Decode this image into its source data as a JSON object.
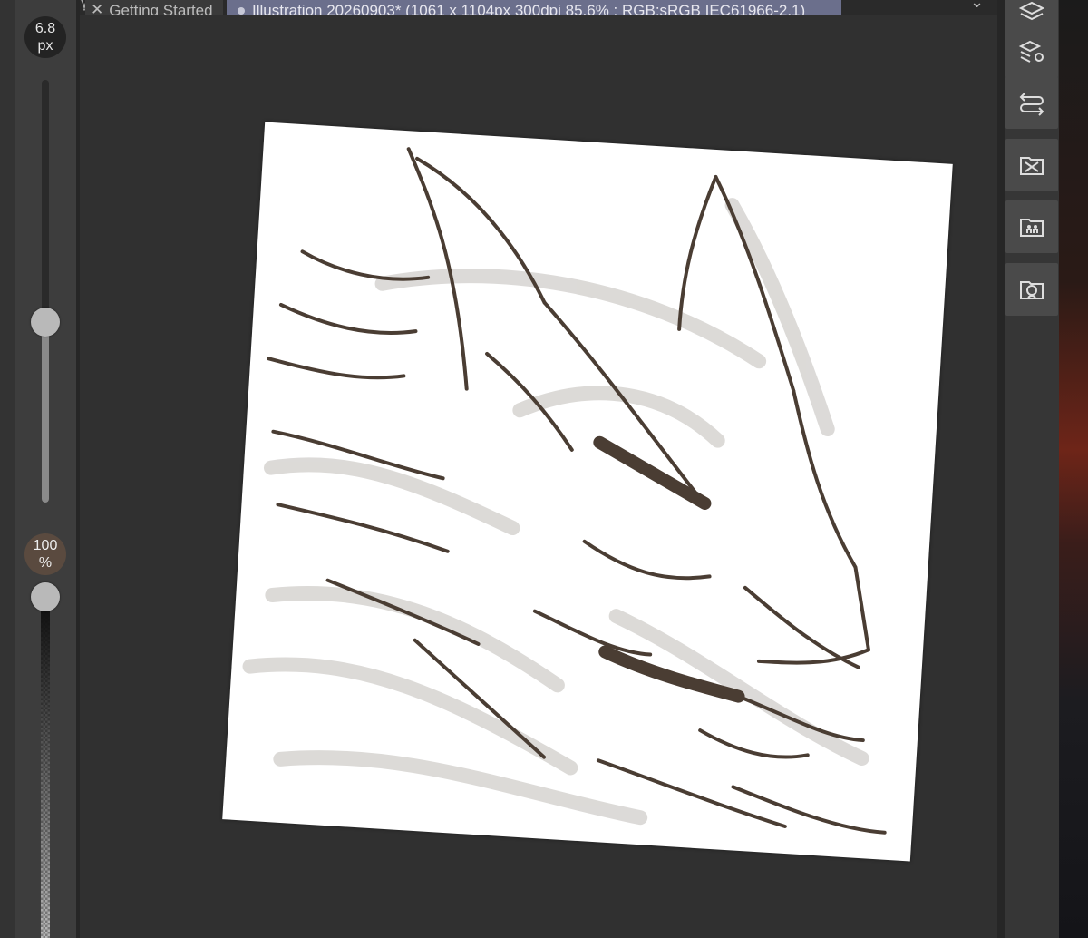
{
  "brush": {
    "size_value": "6.8",
    "size_unit": "px",
    "opacity_value": "100",
    "opacity_unit": "%"
  },
  "tabs": [
    {
      "label": "Getting Started",
      "active": false
    },
    {
      "label": "Illustration 20260903* (1061 x 1104px 300dpi 85.6% : RGB:sRGB IEC61966-2.1)",
      "active": true
    }
  ],
  "icons": {
    "tab_close": "close-icon",
    "tab_overflow": "chevron-down-icon",
    "right_tools": [
      "layers-icon",
      "layer-property-icon",
      "history-icon",
      "material-folder-icon",
      "character-folder-icon",
      "face-folder-icon"
    ]
  },
  "colors": {
    "active_tab": "#6b6f8c",
    "stroke": "#4a3d33",
    "opacity_badge": "#5a4a3f"
  }
}
